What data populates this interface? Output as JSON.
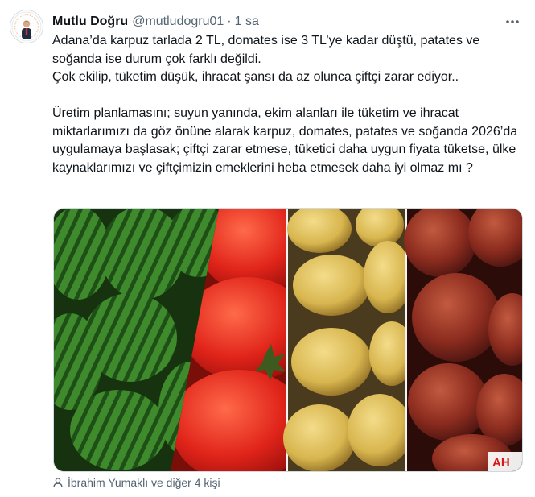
{
  "tweet": {
    "author_name": "Mutlu Doğru",
    "author_handle": "@mutludogru01",
    "separator": "·",
    "timestamp": "1 sa",
    "more_icon": "more-horizontal-icon",
    "paragraph1_line1": "Adana’da karpuz tarlada 2 TL, domates ise 3 TL’ye kadar düştü, patates ve soğanda ise durum çok farklı değildi.",
    "paragraph1_line2": "Çok ekilip, tüketim düşük, ihracat şansı da az olunca çiftçi zarar ediyor..",
    "paragraph2": "Üretim planlamasını; suyun yanında, ekim alanları ile tüketim ve ihracat miktarlarımızı da göz önüne alarak karpuz, domates, patates ve soğanda 2026’da uygulamaya başlasak; çiftçi zarar etmese, tüketici daha uygun fiyata tüketse, ülke kaynaklarımızı ve çiftçimizin emeklerini heba etmesek daha iyi olmaz mı ?",
    "media_watermark": "AH",
    "tagged_people": "İbrahim Yumaklı ve diğer 4 kişi"
  },
  "colors": {
    "text": "#0f1419",
    "secondary": "#536471",
    "border": "#cfd9de"
  }
}
